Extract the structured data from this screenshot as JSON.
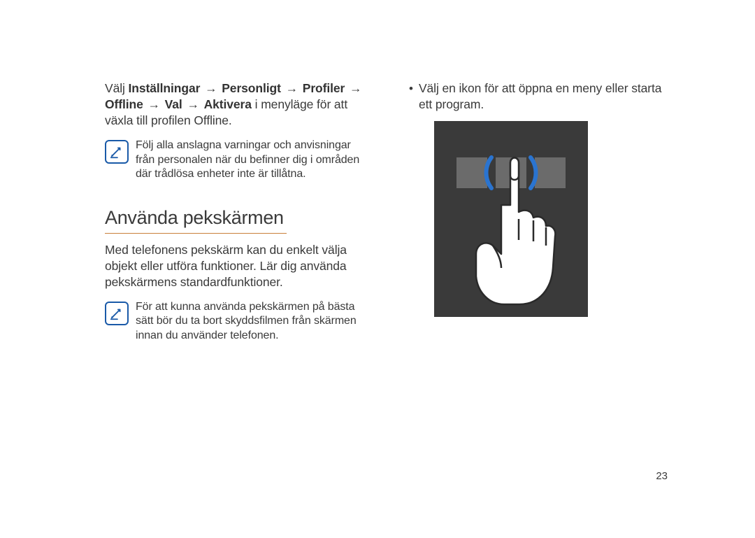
{
  "left": {
    "para1_parts": {
      "p0": "Välj ",
      "p1": "Inställningar",
      "p2": "Personligt",
      "p3": "Profiler",
      "p4": "Offline",
      "p5": "Val",
      "p6": "Aktivera",
      "p7": " i menyläge för att växla till profilen Offline."
    },
    "note1": "Följ alla anslagna varningar och anvisningar från personalen när du befinner dig i områden där trådlösa enheter inte är tillåtna.",
    "heading": "Använda pekskärmen",
    "para2": "Med telefonens pekskärm kan du enkelt välja objekt eller utföra funktioner. Lär dig använda pekskärmens standardfunktioner.",
    "note2": "För att kunna använda pekskärmen på bästa sätt bör du ta bort skyddsfilmen från skärmen innan du använder telefonen."
  },
  "right": {
    "bullet1": "Välj en ikon för att öppna en meny eller starta ett program."
  },
  "glyphs": {
    "arrow": "→"
  },
  "page_number": "23"
}
